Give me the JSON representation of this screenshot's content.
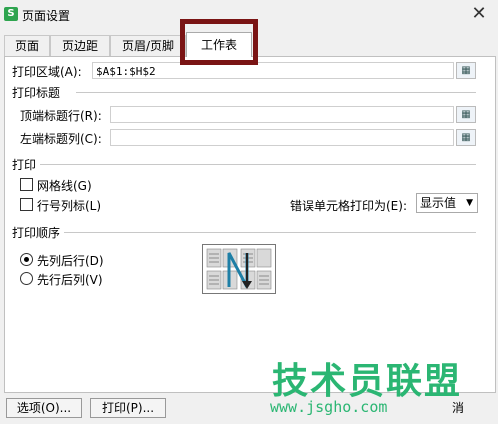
{
  "window": {
    "title": "页面设置",
    "app_icon": "S",
    "close_glyph": "✕"
  },
  "tabs": [
    {
      "label": "页面",
      "active": false
    },
    {
      "label": "页边距",
      "active": false
    },
    {
      "label": "页眉/页脚",
      "active": false
    },
    {
      "label": "工作表",
      "active": true
    }
  ],
  "print_area": {
    "label": "打印区域(A):",
    "value": "$A$1:$H$2"
  },
  "print_titles": {
    "section_title": "打印标题",
    "top_rows_label": "顶端标题行(R):",
    "top_rows_value": "",
    "left_cols_label": "左端标题列(C):",
    "left_cols_value": ""
  },
  "print": {
    "section_title": "打印",
    "gridlines_label": "网格线(G)",
    "gridlines_checked": false,
    "row_col_headers_label": "行号列标(L)",
    "row_col_headers_checked": false,
    "cell_errors_label": "错误单元格打印为(E):",
    "cell_errors_value": "显示值"
  },
  "page_order": {
    "section_title": "打印顺序",
    "down_then_over": "先列后行(D)",
    "over_then_down": "先行后列(V)",
    "selected": "down_then_over"
  },
  "buttons": {
    "options": "选项(O)...",
    "print": "打印(P)...",
    "cancel_fragment": "消"
  },
  "watermark": {
    "text": "技术员联盟",
    "url": "www.jsgho.com"
  },
  "colors": {
    "highlight_box": "#7a1414",
    "watermark": "#2bb673"
  }
}
